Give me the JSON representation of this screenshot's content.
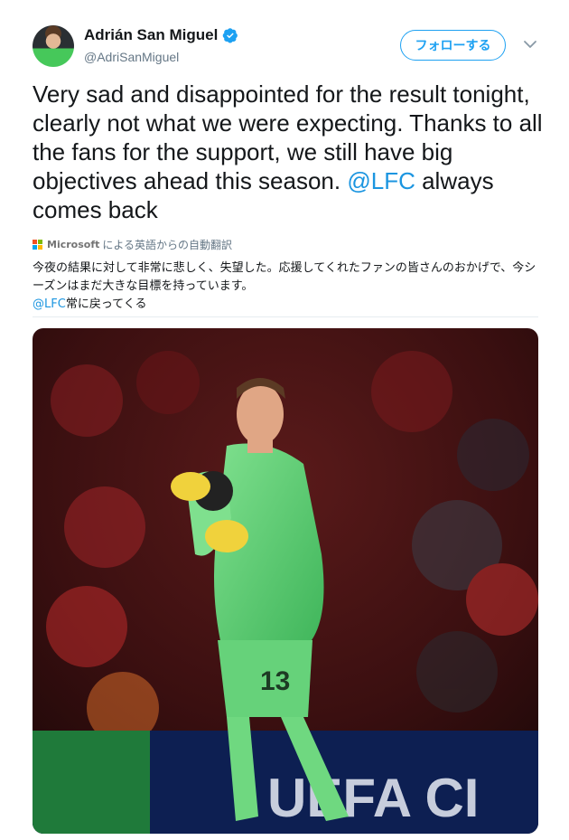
{
  "user": {
    "display_name": "Adrián San Miguel",
    "handle": "@AdriSanMiguel",
    "verified": true
  },
  "actions": {
    "follow_label": "フォローする",
    "more_icon": "chevron-down-icon"
  },
  "tweet": {
    "text_before": "Very sad and disappointed for the result tonight, clearly not what we were expecting. Thanks to all the fans for the support, we still have big objectives ahead this season.",
    "mention": "@LFC",
    "text_after": " always comes back"
  },
  "translation": {
    "provider": "Microsoft",
    "label": "による英語からの自動翻訳",
    "text": "今夜の結果に対して非常に悲しく、失望した。応援してくれたファンの皆さんのおかげで、今シーズンはまだ大きな目標を持っています。",
    "mention": "@LFC",
    "text_after": "常に戻ってくる"
  },
  "media": {
    "shirt_number": "13",
    "board_text": "UEFA CI",
    "description_icon": "photo"
  },
  "colors": {
    "accent": "#1da1f2",
    "link": "#1b95e0",
    "secondary": "#657786"
  }
}
